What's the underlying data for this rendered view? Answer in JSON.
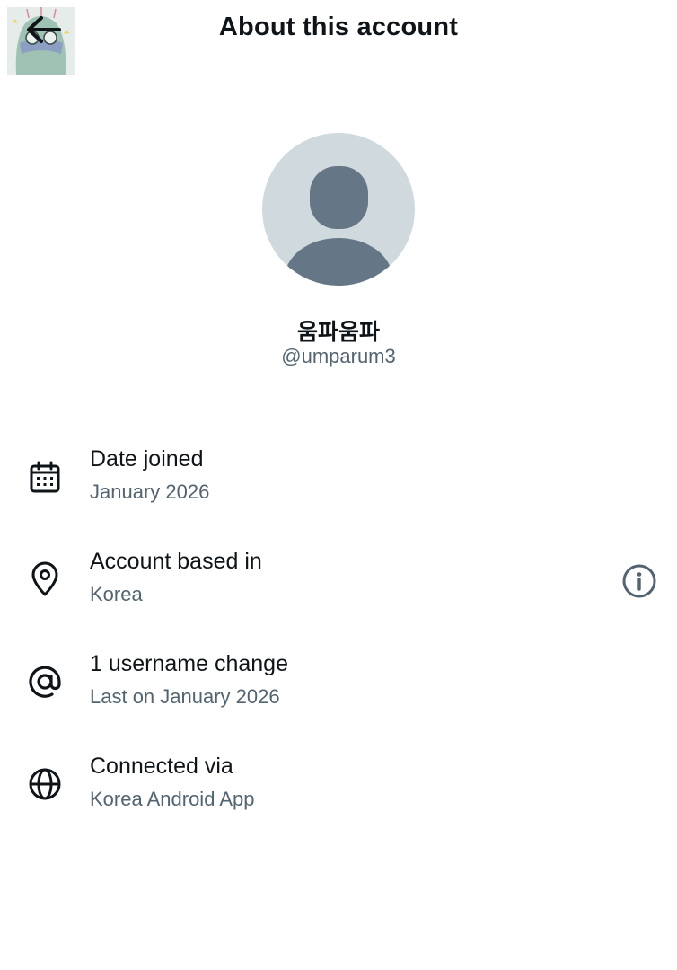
{
  "header": {
    "title": "About this account",
    "back_icon": "arrow-left-icon"
  },
  "profile": {
    "display_name": "움파움파",
    "handle": "@umparum3",
    "avatar_icon": "default-avatar-icon"
  },
  "details": [
    {
      "label": "Date joined",
      "value": "January 2026",
      "icon": "calendar-icon"
    },
    {
      "label": "Account based in",
      "value": "Korea",
      "icon": "location-pin-icon",
      "extra_icon": "info-icon"
    },
    {
      "label": "1 username change",
      "value": "Last on January 2026",
      "icon": "at-sign-icon"
    },
    {
      "label": "Connected via",
      "value": "Korea Android App",
      "icon": "globe-icon"
    }
  ],
  "colors": {
    "text_primary": "#0f1419",
    "text_secondary": "#536471",
    "avatar_bg": "#cfd9de",
    "avatar_fg": "#657786"
  }
}
